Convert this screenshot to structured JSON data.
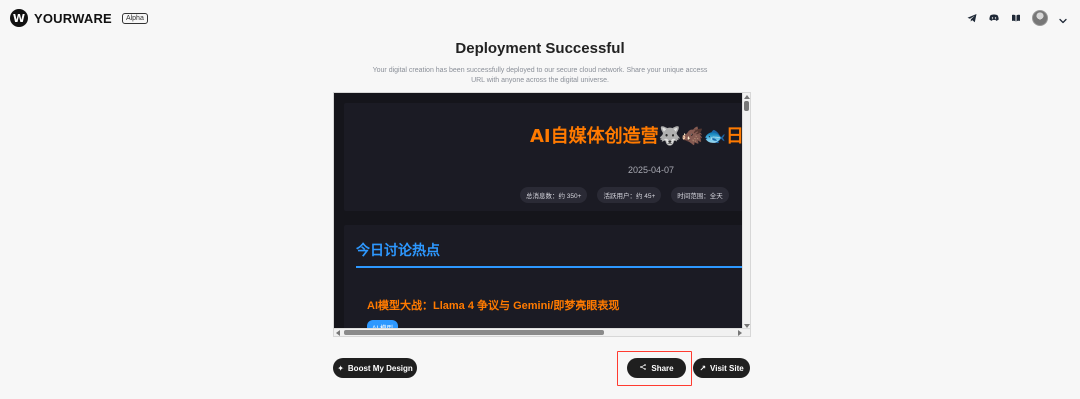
{
  "header": {
    "brand_initial": "W",
    "brand_name": "YOURWARE",
    "badge": "Alpha",
    "icons": [
      "telegram-icon",
      "discord-icon",
      "book-icon"
    ],
    "avatar": "user-avatar",
    "menu_icon": "chevron-down-icon"
  },
  "hero": {
    "title": "Deployment Successful",
    "subtitle": "Your digital creation has been successfully deployed to our secure cloud network. Share your unique access URL with anyone across the digital universe."
  },
  "preview": {
    "main_title": "AI自媒体创造营🐺🐗🐟日",
    "date": "2025-04-07",
    "stats": [
      "总消息数：约 350+",
      "活跃用户：约 45+",
      "时间范围：全天"
    ],
    "section_title": "今日讨论热点",
    "topic_title": "AI模型大战：Llama 4 争议与 Gemini/即梦亮眼表现",
    "tag": "AI 模型",
    "colors": {
      "accent": "#ff7a00",
      "blue": "#2d98ff",
      "bg": "#15151b"
    }
  },
  "actions": {
    "boost": "Boost My Design",
    "share": "Share",
    "visit": "Visit Site"
  }
}
